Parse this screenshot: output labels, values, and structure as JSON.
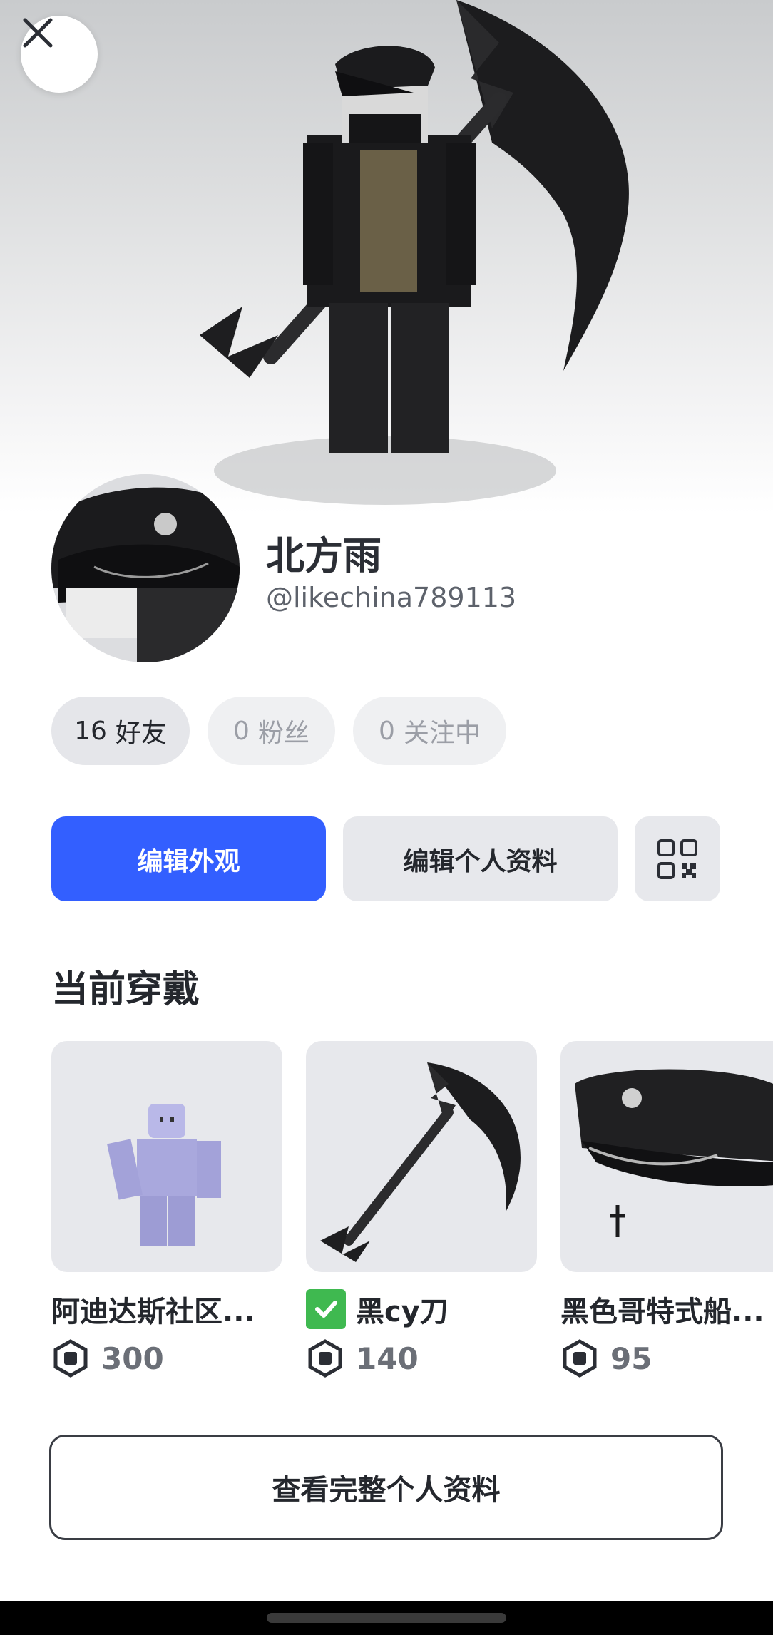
{
  "header": {
    "close_icon": "close-icon"
  },
  "profile": {
    "display_name": "北方雨",
    "username": "@likechina789113"
  },
  "stats": {
    "friends": {
      "count": "16",
      "label": "好友"
    },
    "followers": {
      "count": "0",
      "label": "粉丝"
    },
    "following": {
      "count": "0",
      "label": "关注中"
    }
  },
  "actions": {
    "edit_avatar": "编辑外观",
    "edit_profile": "编辑个人资料",
    "qr_icon": "qr-code-icon"
  },
  "currently_wearing": {
    "title": "当前穿戴",
    "items": [
      {
        "name": "阿迪达斯社区...",
        "price": "300",
        "verified": false
      },
      {
        "name": "黑cy刀",
        "price": "140",
        "verified": true
      },
      {
        "name": "黑色哥特式船...",
        "price": "95",
        "verified": false
      }
    ]
  },
  "footer": {
    "view_full_profile": "查看完整个人资料"
  },
  "colors": {
    "primary": "#335fff",
    "secondary_button": "#e7e8ec",
    "verified": "#3fb950"
  }
}
